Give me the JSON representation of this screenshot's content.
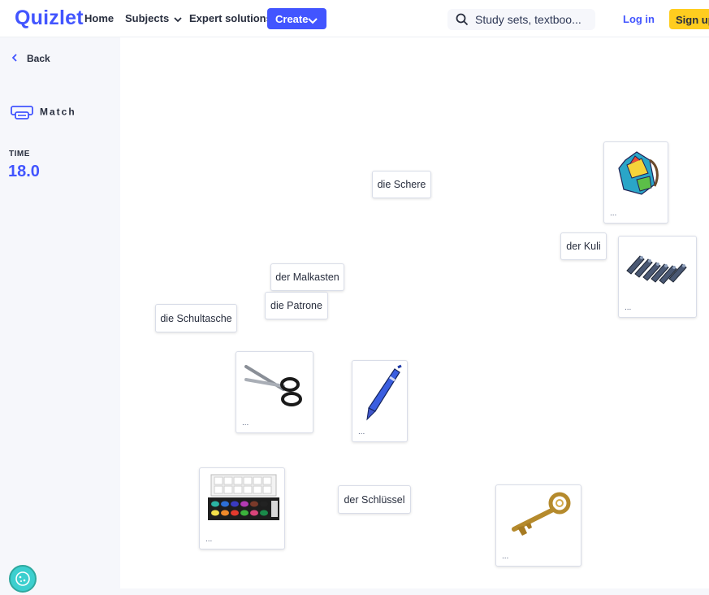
{
  "header": {
    "logo": "Quizlet",
    "nav": {
      "home": "Home",
      "subjects": "Subjects",
      "expert": "Expert solutions"
    },
    "create": "Create",
    "search_placeholder": "Study sets, textboo...",
    "login": "Log in",
    "signup": "Sign up"
  },
  "sidebar": {
    "back": "Back",
    "mode": "Match",
    "time_label": "TIME",
    "time_value": "18.0"
  },
  "board": {
    "terms": [
      "die Schere",
      "der Kuli",
      "der Malkasten",
      "die Patrone",
      "die Schultasche",
      "der Schlüssel"
    ],
    "image_cards": [
      {
        "icon": "backpack-image",
        "caption": "..."
      },
      {
        "icon": "ink-cartridges-image",
        "caption": "..."
      },
      {
        "icon": "scissors-image",
        "caption": "..."
      },
      {
        "icon": "pen-image",
        "caption": "..."
      },
      {
        "icon": "paint-box-image",
        "caption": "..."
      },
      {
        "icon": "key-image",
        "caption": "..."
      }
    ]
  },
  "colors": {
    "brand": "#4255ff",
    "signup": "#ffcd1f",
    "board": "#ffffff",
    "sidebar": "#f6f7fb"
  }
}
